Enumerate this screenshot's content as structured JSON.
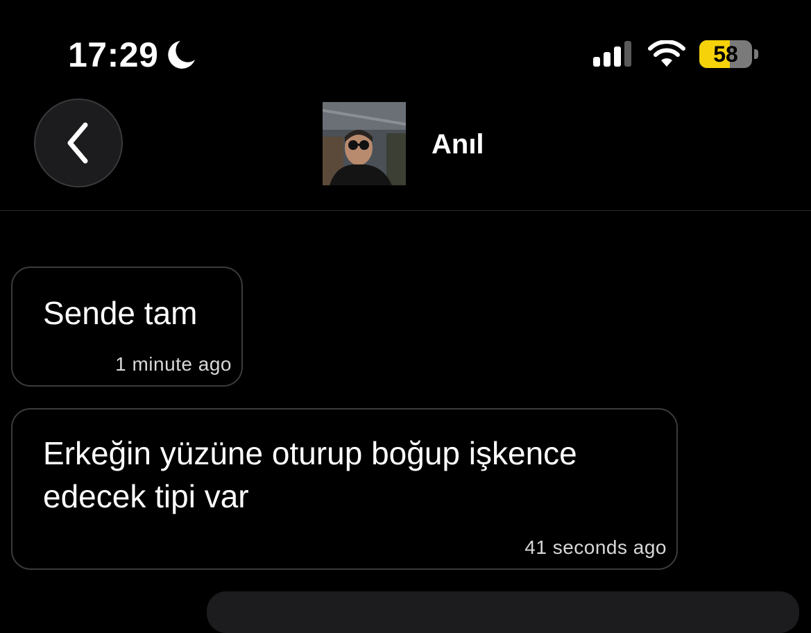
{
  "status_bar": {
    "time": "17:29",
    "focus_icon": "moon-icon",
    "signal_icon": "cellular-signal-icon",
    "wifi_icon": "wifi-icon",
    "battery_percent": "58",
    "battery_level": 0.58,
    "battery_color": "#f5d20a"
  },
  "header": {
    "back_icon": "chevron-left-icon",
    "contact_name": "Anıl",
    "avatar_icon": "contact-avatar-photo"
  },
  "messages": [
    {
      "text": "Sende tam",
      "time": "1 minute ago"
    },
    {
      "text": "Erkeğin yüzüne oturup boğup işkence edecek tipi var",
      "time": "41 seconds ago"
    }
  ]
}
